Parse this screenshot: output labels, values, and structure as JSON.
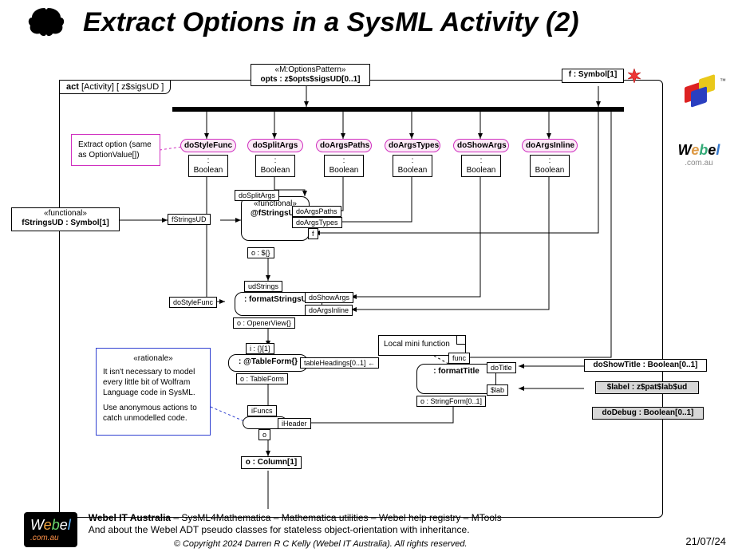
{
  "title": "Extract Options in a SysML Activity (2)",
  "frame_label": {
    "kw": "act",
    "type": "[Activity]",
    "name": "[ z$sigsUD ]"
  },
  "opts_box": {
    "stereo": "«M:OptionsPattern»",
    "label": "opts : z$opts$sigsUD[0..1]"
  },
  "f_symbol": "f : Symbol[1]",
  "pills": {
    "doStyleFunc": "doStyleFunc",
    "doSplitArgs": "doSplitArgs",
    "doArgsPaths": "doArgsPaths",
    "doArgsTypes": "doArgsTypes",
    "doShowArgs": "doShowArgs",
    "doArgsInline": "doArgsInline"
  },
  "pill_type": ": Boolean",
  "note_pink": "Extract option (same as OptionValue[])",
  "functional_box": {
    "stereo": "«functional»",
    "label": "fStringsUD : Symbol[1]"
  },
  "fStringsUD_action": {
    "stereo": "«functional»",
    "name": "@fStringsUD"
  },
  "fStringsUD_pin_in": "fStringsUD",
  "fStringsUD_pins_right": {
    "doSplitArgs": "doSplitArgs",
    "doArgsPaths": "doArgsPaths",
    "doArgsTypes": "doArgsTypes",
    "f": "f"
  },
  "fStringsUD_out": "o : ${}",
  "formatStringsUD": {
    "name": ": formatStringsUD",
    "in_top": "udStrings",
    "in_left": "doStyleFunc",
    "out": "o : OpenerView{}",
    "r1": "doShowArgs",
    "r2": "doArgsInline"
  },
  "tableForm": {
    "name": ": @TableForm{}",
    "in_top": "i : {}[1]",
    "out": "o : TableForm",
    "right": "tableHeadings[0..1] ←"
  },
  "formatTitle": {
    "name": ": formatTitle",
    "in_top": "func",
    "out": "o : StringForm[0..1]",
    "r1": "doTitle",
    "r2": "$lab"
  },
  "local_mini": "Local mini function",
  "iFuncs": {
    "in_top": "iFuncs",
    "out": "o",
    "right": "iHeader"
  },
  "column_out": "o : Column[1]",
  "rationale": {
    "stereo": "«rationale»",
    "body1": "It isn't necessary to model every little bit of Wolfram Language code in SysML.",
    "body2": "Use anonymous actions to catch unmodelled code."
  },
  "right_rows": {
    "doShowTitle": "doShowTitle : Boolean[0..1]",
    "label": "$label : z$pat$lab$ud",
    "doDebug": "doDebug : Boolean[0..1]"
  },
  "footer": {
    "l1_bold": "Webel IT Australia",
    "l1_rest": "  –  SysML4Mathematica – Mathematica utilities – Webel help registry – MTools",
    "l2": "And about the Webel ADT pseudo classes for stateless object-orientation with inheritance.",
    "copyright": "© Copyright 2024 Darren R C Kelly (Webel IT Australia). All rights reserved.",
    "date": "21/07/24"
  }
}
